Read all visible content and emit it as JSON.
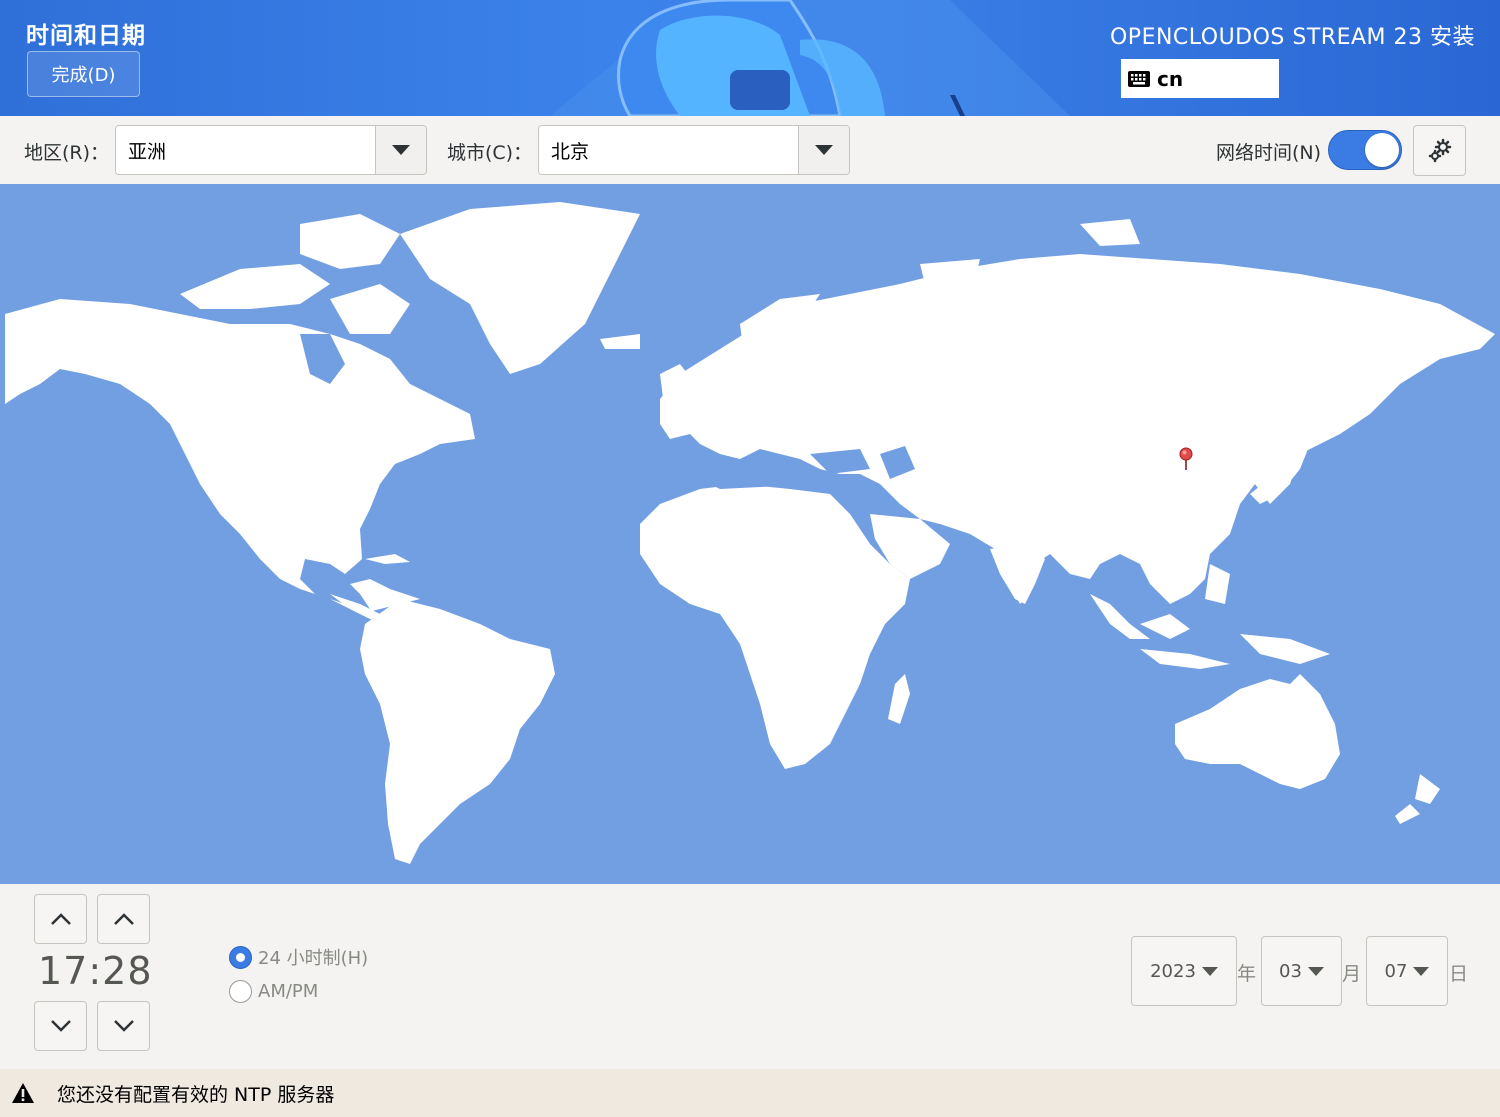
{
  "header": {
    "page_title": "时间和日期",
    "done_button": "完成(D)",
    "install_title": "OPENCLOUDOS STREAM 23 安装",
    "keyboard_layout": "cn"
  },
  "toolbar": {
    "region_label": "地区(R)：",
    "region_value": "亚洲",
    "city_label": "城市(C)：",
    "city_value": "北京",
    "ntp_label": "网络时间(N)",
    "ntp_enabled": true
  },
  "map": {
    "selected_city": "北京"
  },
  "time": {
    "display": "17:28",
    "format_24h_label": "24 小时制(H)",
    "format_ampm_label": "AM/PM",
    "selected_format": "24h"
  },
  "date": {
    "year": "2023",
    "year_unit": "年",
    "month": "03",
    "month_unit": "月",
    "day": "07",
    "day_unit": "日"
  },
  "status": {
    "message": "您还没有配置有效的 NTP 服务器"
  },
  "colors": {
    "accent": "#3b7ce4",
    "map_water": "#729fe2",
    "header": "#3b82ea",
    "status_bar": "#efe9e0"
  }
}
